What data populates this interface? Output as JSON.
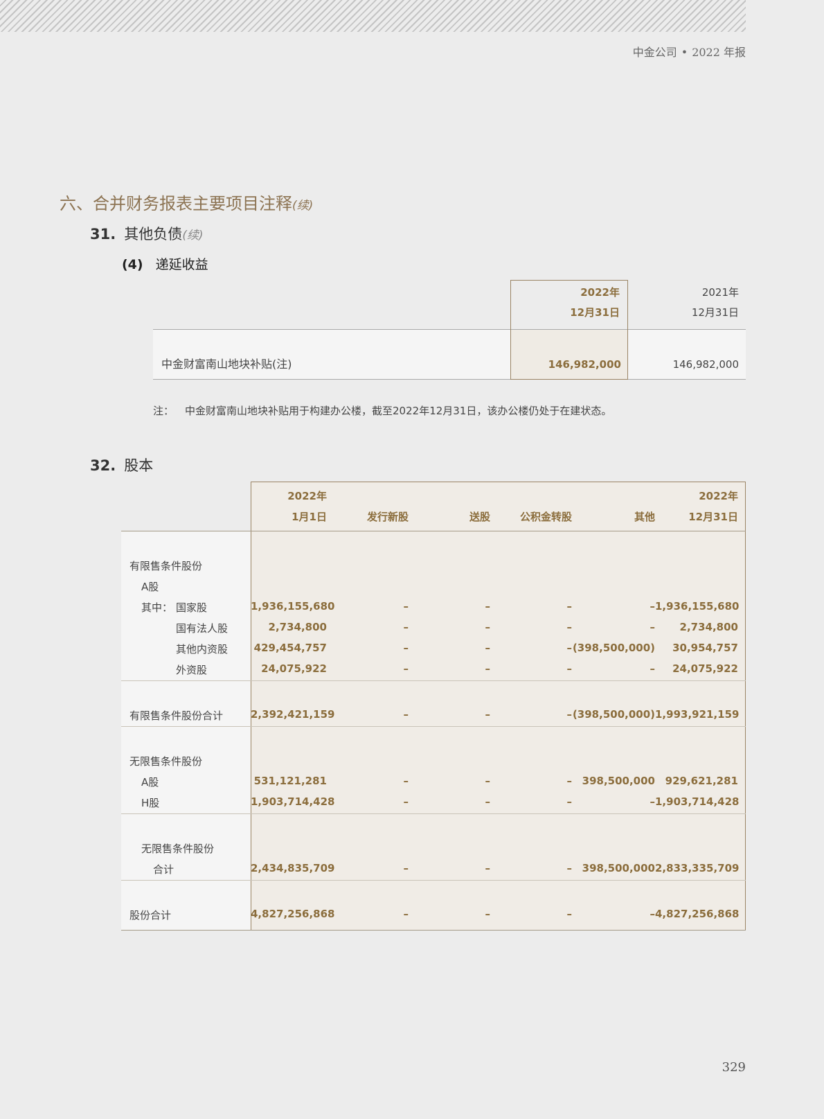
{
  "header": {
    "company": "中金公司",
    "report": "2022 年报"
  },
  "section_title": "六、合并财务报表主要项目注释",
  "continued": "(续)",
  "sec31": {
    "num": "31.",
    "title": "其他负债",
    "continued": "(续)"
  },
  "sec31_4": {
    "num": "(4)",
    "title": "递延收益"
  },
  "table1": {
    "col_2022": [
      "2022年",
      "12月31日"
    ],
    "col_2021": [
      "2021年",
      "12月31日"
    ],
    "row_label": "中金财富南山地块补贴(注)",
    "val_2022": "146,982,000",
    "val_2021": "146,982,000"
  },
  "note": {
    "label": "注：",
    "text": "中金财富南山地块补贴用于构建办公楼，截至2022年12月31日，该办公楼仍处于在建状态。"
  },
  "sec32": {
    "num": "32.",
    "title": "股本"
  },
  "table2": {
    "headers": {
      "c1": [
        "2022年",
        "1月1日"
      ],
      "c2": "发行新股",
      "c3": "送股",
      "c4": "公积金转股",
      "c5": "其他",
      "c6": [
        "2022年",
        "12月31日"
      ]
    },
    "dash": "–",
    "restricted": "有限售条件股份",
    "a_share": "A股",
    "of_which": "其中：",
    "rows_restricted": [
      {
        "label": "国家股",
        "c1": "1,936,155,680",
        "c5": "–",
        "c6": "1,936,155,680"
      },
      {
        "label": "国有法人股",
        "c1": "2,734,800",
        "c5": "–",
        "c6": "2,734,800"
      },
      {
        "label": "其他内资股",
        "c1": "429,454,757",
        "c5": "(398,500,000)",
        "c6": "30,954,757"
      },
      {
        "label": "外资股",
        "c1": "24,075,922",
        "c5": "–",
        "c6": "24,075,922"
      }
    ],
    "restricted_total": {
      "label": "有限售条件股份合计",
      "c1": "2,392,421,159",
      "c5": "(398,500,000)",
      "c6": "1,993,921,159"
    },
    "unrestricted": "无限售条件股份",
    "rows_unrestricted": [
      {
        "label": "A股",
        "c1": "531,121,281",
        "c5": "398,500,000",
        "c6": "929,621,281"
      },
      {
        "label": "H股",
        "c1": "1,903,714,428",
        "c5": "–",
        "c6": "1,903,714,428"
      }
    ],
    "unrestricted_total": {
      "label1": "无限售条件股份",
      "label2": "合计",
      "c1": "2,434,835,709",
      "c5": "398,500,000",
      "c6": "2,833,335,709"
    },
    "grand_total": {
      "label": "股份合计",
      "c1": "4,827,256,868",
      "c5": "–",
      "c6": "4,827,256,868"
    }
  },
  "page_number": "329"
}
